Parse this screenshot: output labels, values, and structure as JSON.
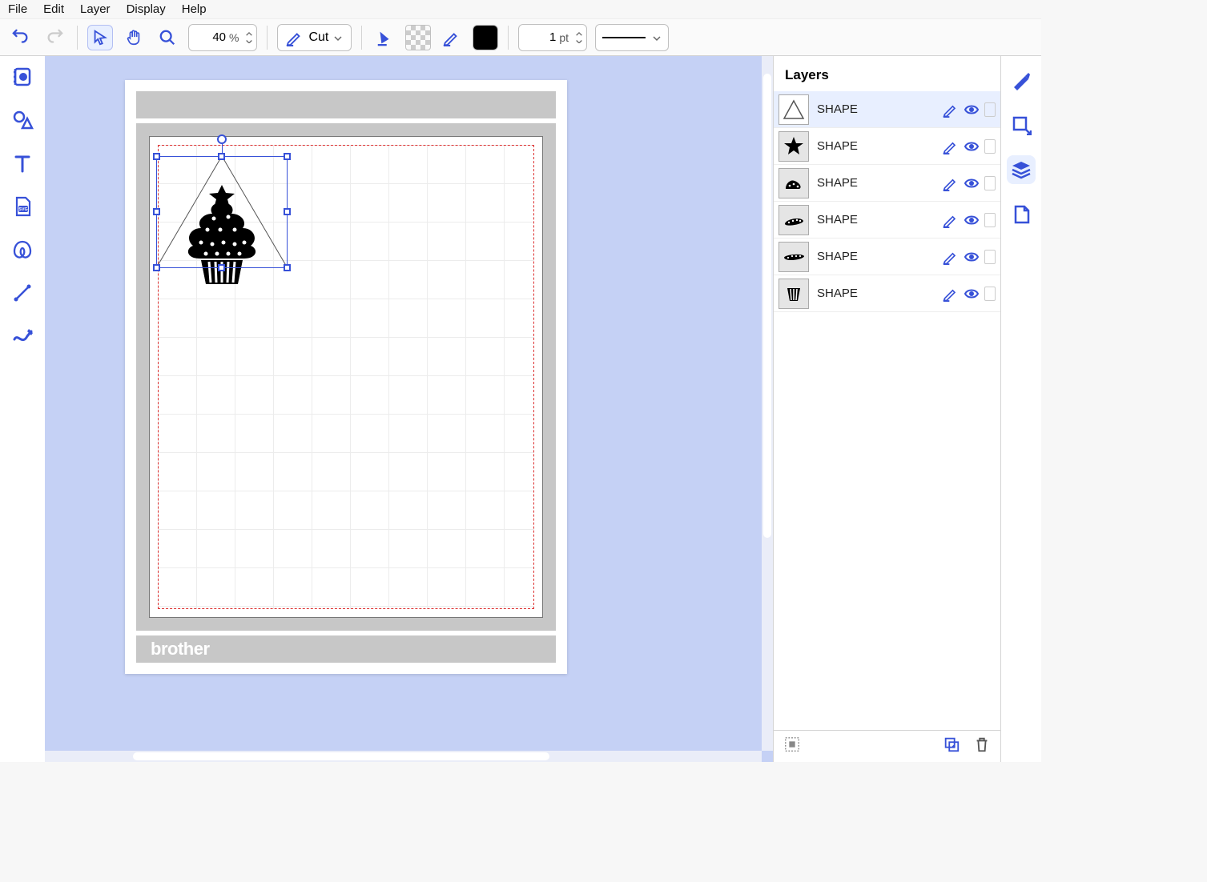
{
  "menubar": {
    "file": "File",
    "edit": "Edit",
    "layer": "Layer",
    "display": "Display",
    "help": "Help"
  },
  "toolbar": {
    "zoom_value": "40",
    "zoom_unit": "%",
    "cut_label": "Cut",
    "stroke_value": "1",
    "stroke_unit": "pt"
  },
  "brand": "brother",
  "layers": {
    "title": "Layers",
    "items": [
      {
        "label": "SHAPE"
      },
      {
        "label": "SHAPE"
      },
      {
        "label": "SHAPE"
      },
      {
        "label": "SHAPE"
      },
      {
        "label": "SHAPE"
      },
      {
        "label": "SHAPE"
      }
    ]
  },
  "colors": {
    "blue": "#3751d8"
  }
}
